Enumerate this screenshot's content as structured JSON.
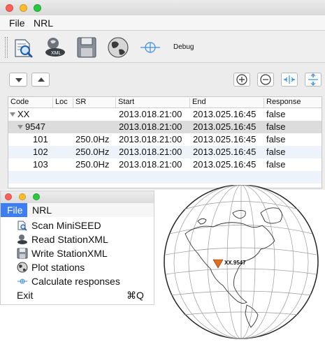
{
  "main_window": {
    "menu": [
      "File",
      "NRL"
    ],
    "toolbar": {
      "buttons": [
        "scan-miniseed",
        "read-stationxml",
        "write-stationxml",
        "plot-stations",
        "calculate-responses"
      ],
      "debug_label": "Debug"
    },
    "table": {
      "columns": [
        "Code",
        "Loc",
        "SR",
        "Start",
        "End",
        "Response"
      ],
      "rows": [
        {
          "code": "XX",
          "loc": "",
          "sr": "",
          "start": "2013.018.21:00",
          "end": "2013.025.16:45",
          "response": "false",
          "level": 0,
          "selected": false
        },
        {
          "code": "9547",
          "loc": "",
          "sr": "",
          "start": "2013.018.21:00",
          "end": "2013.025.16:45",
          "response": "false",
          "level": 1,
          "selected": true
        },
        {
          "code": "101",
          "loc": "",
          "sr": "250.0Hz",
          "start": "2013.018.21:00",
          "end": "2013.025.16:45",
          "response": "false",
          "level": 2,
          "selected": false
        },
        {
          "code": "102",
          "loc": "",
          "sr": "250.0Hz",
          "start": "2013.018.21:00",
          "end": "2013.025.16:45",
          "response": "false",
          "level": 2,
          "selected": false
        },
        {
          "code": "103",
          "loc": "",
          "sr": "250.0Hz",
          "start": "2013.018.21:00",
          "end": "2013.025.16:45",
          "response": "false",
          "level": 2,
          "selected": false
        }
      ]
    }
  },
  "menu_window": {
    "menu": [
      "File",
      "NRL"
    ],
    "file_menu_items": [
      {
        "label": "Scan MiniSEED",
        "icon": "scan-icon",
        "shortcut": ""
      },
      {
        "label": "Read StationXML",
        "icon": "read-xml-icon",
        "shortcut": ""
      },
      {
        "label": "Write StationXML",
        "icon": "floppy-icon",
        "shortcut": ""
      },
      {
        "label": "Plot stations",
        "icon": "globe-icon",
        "shortcut": ""
      },
      {
        "label": "Calculate responses",
        "icon": "crosshair-icon",
        "shortcut": ""
      },
      {
        "label": "Exit",
        "icon": "",
        "shortcut": "⌘Q"
      }
    ]
  },
  "globe": {
    "station_label": "XX.9547"
  },
  "colors": {
    "accent": "#3d7ff2",
    "traffic_red": "#ff5f57",
    "traffic_yellow": "#febc2e",
    "traffic_green": "#28c840",
    "selected_row": "#dcdcdc",
    "alt_row": "#eef3fb",
    "station_marker": "#e0701f"
  }
}
